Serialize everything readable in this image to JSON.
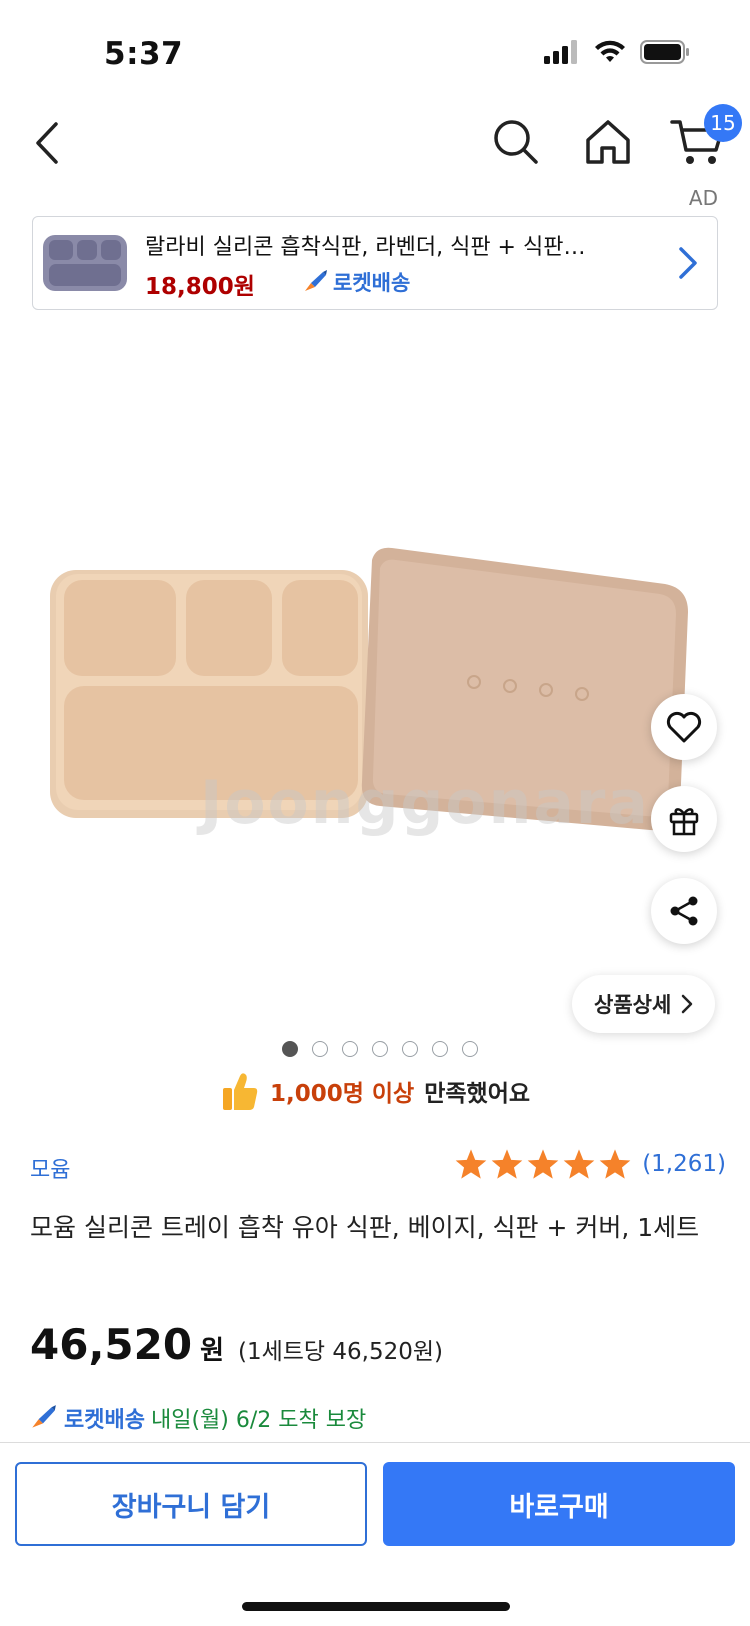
{
  "status_bar": {
    "time": "5:37"
  },
  "nav": {
    "cart_count": "15"
  },
  "ad": {
    "label": "AD",
    "title": "랄라비 실리콘 흡착식판, 라벤더, 식판 + 식판…",
    "price": "18,800원",
    "delivery_label": "로켓배송"
  },
  "image": {
    "watermark": "Joonggonara",
    "detail_button": "상품상세",
    "pages": 7,
    "current_page": 1
  },
  "satisfaction": {
    "highlight": "1,000명 이상",
    "rest": "만족했어요"
  },
  "product": {
    "brand": "모윰",
    "rating_stars": 5,
    "rating_count": "(1,261)",
    "title": "모윰 실리콘 트레이 흡착 유아 식판, 베이지, 식판 + 커버, 1세트",
    "price": "46,520",
    "currency": "원",
    "unit_price": "(1세트당 46,520원)",
    "delivery_label": "로켓배송",
    "delivery_date": "내일(월) 6/2 도착 보장"
  },
  "actions": {
    "add_to_cart": "장바구니 담기",
    "buy_now": "바로구매"
  },
  "colors": {
    "accent": "#3478f6",
    "price_red": "#ae0000",
    "star": "#f5822a",
    "arrival_green": "#1a8a3c"
  }
}
